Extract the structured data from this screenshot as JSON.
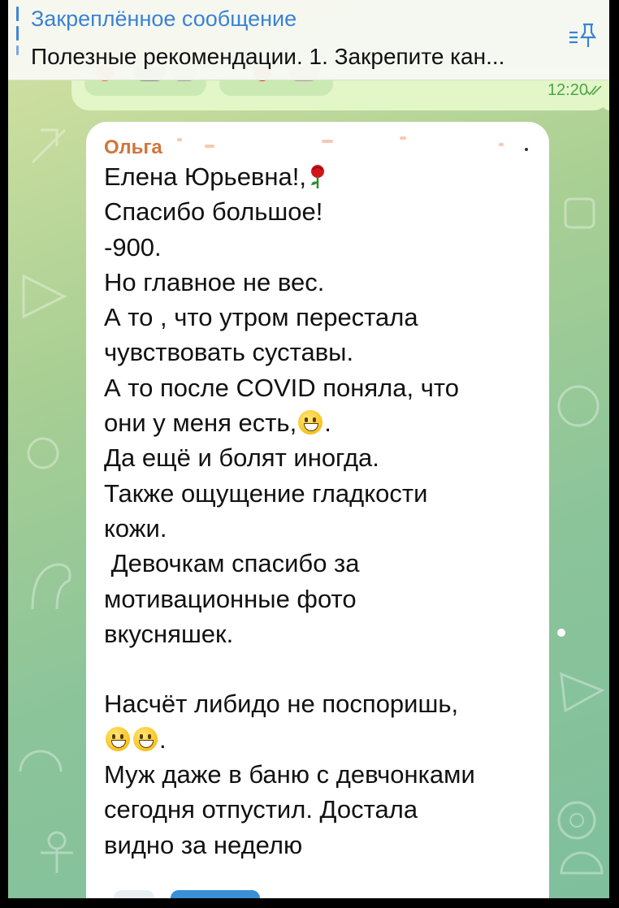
{
  "pinned": {
    "title": "Закреплённое сообщение",
    "text": "Полезные рекомендации. 1. Закрепите кан...",
    "icon": "pinned-list-icon"
  },
  "previous_message": {
    "time": "12:20",
    "status_icon": "double-check-icon",
    "reactions": [
      "fire-icon",
      "heart-icon"
    ]
  },
  "message": {
    "sender": "Ольга",
    "lines": [
      "Елена Юрьевна!,",
      "Спасибо большое!",
      "-900.",
      "Но главное не вес.",
      "А  то , что утром перестала",
      "чувствовать суставы.",
      "А то после  COVID поняла, что",
      "они у меня есть,",
      "Да ещё и болят иногда.",
      "Также ощущение гладкости",
      "кожи.",
      " Девочкам спасибо за",
      "мотивационные фото",
      "вкусняшек.",
      "",
      "Насчёт либидо не поспоришь,",
      "",
      "Муж даже в баню с девчонками",
      "сегодня отпустил. Достала",
      "видно за неделю"
    ],
    "inline_icons": {
      "rose": "rose-emoji-icon",
      "smile": "grinning-face-emoji-icon"
    }
  },
  "colors": {
    "accent": "#3a82d3",
    "sender": "#d2743b",
    "outgoing_bubble": "#e2f6c8",
    "incoming_bubble": "#ffffff",
    "time_green": "#4ea546"
  }
}
